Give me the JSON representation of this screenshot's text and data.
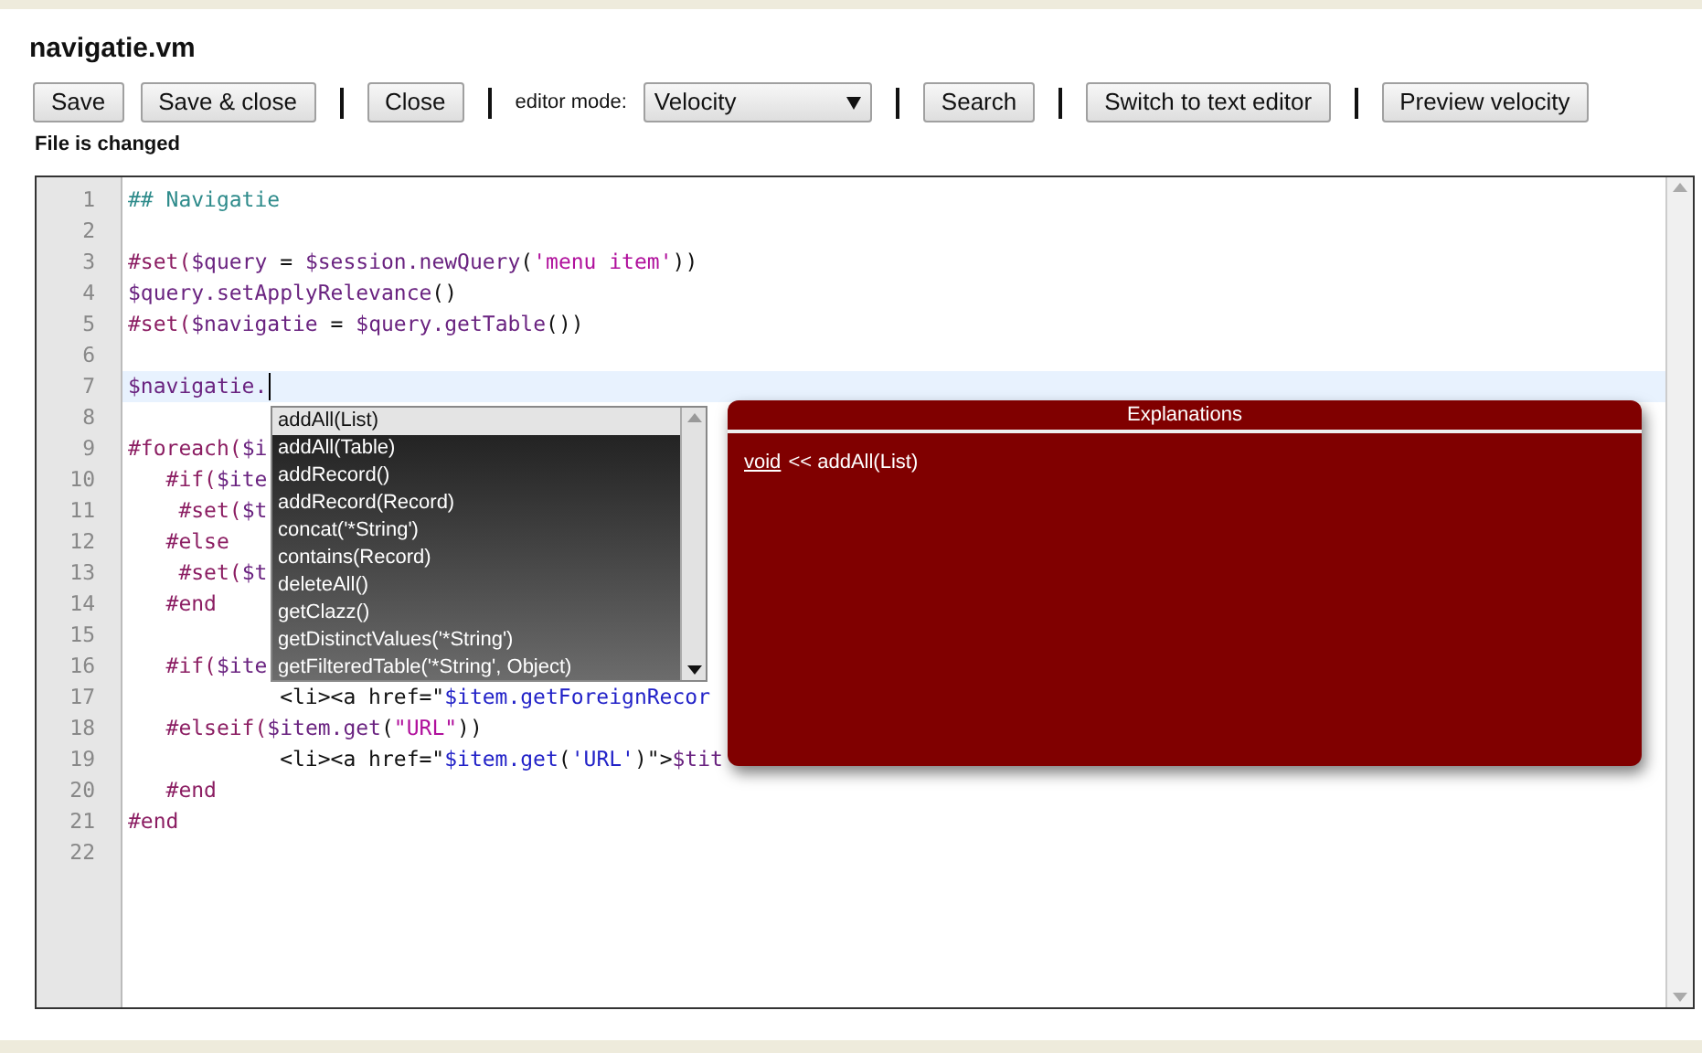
{
  "title": "navigatie.vm",
  "toolbar": [
    {
      "kind": "button",
      "label": "Save"
    },
    {
      "kind": "button",
      "label": "Save & close"
    },
    {
      "kind": "separator"
    },
    {
      "kind": "button",
      "label": "Close"
    },
    {
      "kind": "separator"
    },
    {
      "kind": "label",
      "label": "editor mode:"
    },
    {
      "kind": "select",
      "value": "Velocity"
    },
    {
      "kind": "separator"
    },
    {
      "kind": "button",
      "label": "Search"
    },
    {
      "kind": "separator"
    },
    {
      "kind": "button",
      "label": "Switch to text editor"
    },
    {
      "kind": "separator"
    },
    {
      "kind": "button",
      "label": "Preview velocity"
    }
  ],
  "status": "File is changed",
  "editor": {
    "lines": [
      {
        "number": "1",
        "selected": false,
        "tokens": [
          {
            "kind": "comment",
            "text": "## Navigatie"
          }
        ]
      },
      {
        "number": "2",
        "selected": false
      },
      {
        "number": "3",
        "selected": false,
        "tokens": [
          {
            "kind": "directive",
            "text": "#set("
          },
          {
            "kind": "var",
            "text": "$query"
          },
          {
            "kind": "plain",
            "text": " = "
          },
          {
            "kind": "var",
            "text": "$session.newQuery"
          },
          {
            "kind": "plain",
            "text": "("
          },
          {
            "kind": "string",
            "text": "'menu item'"
          },
          {
            "kind": "plain",
            "text": "))"
          }
        ]
      },
      {
        "number": "4",
        "selected": false,
        "tokens": [
          {
            "kind": "var",
            "text": "$query.setApplyRelevance"
          },
          {
            "kind": "plain",
            "text": "()"
          }
        ]
      },
      {
        "number": "5",
        "selected": false,
        "tokens": [
          {
            "kind": "directive",
            "text": "#set("
          },
          {
            "kind": "var",
            "text": "$navigatie"
          },
          {
            "kind": "plain",
            "text": " = "
          },
          {
            "kind": "var",
            "text": "$query.getTable"
          },
          {
            "kind": "plain",
            "text": "())"
          }
        ]
      },
      {
        "number": "6",
        "selected": false
      },
      {
        "number": "7",
        "selected": true,
        "tokens": [
          {
            "kind": "var",
            "text": "$navigatie."
          }
        ]
      },
      {
        "number": "8",
        "selected": false
      },
      {
        "number": "9",
        "selected": false,
        "tokens": [
          {
            "kind": "directive",
            "text": "#foreach("
          },
          {
            "kind": "var",
            "text": "$i"
          }
        ]
      },
      {
        "number": "10",
        "selected": false,
        "tokens": [
          {
            "kind": "directive",
            "text": "   #if("
          },
          {
            "kind": "var",
            "text": "$ite"
          }
        ]
      },
      {
        "number": "11",
        "selected": false,
        "tokens": [
          {
            "kind": "directive",
            "text": "    #set("
          },
          {
            "kind": "var",
            "text": "$t"
          }
        ]
      },
      {
        "number": "12",
        "selected": false,
        "tokens": [
          {
            "kind": "directive",
            "text": "   #else"
          }
        ]
      },
      {
        "number": "13",
        "selected": false,
        "tokens": [
          {
            "kind": "directive",
            "text": "    #set("
          },
          {
            "kind": "var",
            "text": "$t"
          }
        ]
      },
      {
        "number": "14",
        "selected": false,
        "tokens": [
          {
            "kind": "directive",
            "text": "   #end"
          }
        ]
      },
      {
        "number": "15",
        "selected": false
      },
      {
        "number": "16",
        "selected": false,
        "tokens": [
          {
            "kind": "directive",
            "text": "   #if("
          },
          {
            "kind": "var",
            "text": "$ite"
          }
        ]
      },
      {
        "number": "17",
        "selected": false,
        "tokens": [
          {
            "kind": "plain",
            "text": "            <li><a href=\""
          },
          {
            "kind": "link",
            "text": "$item.getForeignRecor"
          }
        ]
      },
      {
        "number": "18",
        "selected": false,
        "tokens": [
          {
            "kind": "directive",
            "text": "   #elseif("
          },
          {
            "kind": "var",
            "text": "$item.get"
          },
          {
            "kind": "plain",
            "text": "("
          },
          {
            "kind": "string",
            "text": "\"URL\""
          },
          {
            "kind": "plain",
            "text": "))"
          }
        ]
      },
      {
        "number": "19",
        "selected": false,
        "tokens": [
          {
            "kind": "plain",
            "text": "            <li><a href=\""
          },
          {
            "kind": "link",
            "text": "$item.get"
          },
          {
            "kind": "plain",
            "text": "("
          },
          {
            "kind": "link",
            "text": "'URL'"
          },
          {
            "kind": "plain",
            "text": ")\">"
          },
          {
            "kind": "var",
            "text": "$tit"
          }
        ]
      },
      {
        "number": "20",
        "selected": false,
        "tokens": [
          {
            "kind": "directive",
            "text": "   #end"
          }
        ]
      },
      {
        "number": "21",
        "selected": false,
        "tokens": [
          {
            "kind": "directive",
            "text": "#end"
          }
        ]
      },
      {
        "number": "22",
        "selected": false
      }
    ]
  },
  "autocomplete": [
    {
      "label": "addAll(List)",
      "selected": true
    },
    {
      "label": "addAll(Table)",
      "selected": false
    },
    {
      "label": "addRecord()",
      "selected": false
    },
    {
      "label": "addRecord(Record)",
      "selected": false
    },
    {
      "label": "concat('*String')",
      "selected": false
    },
    {
      "label": "contains(Record)",
      "selected": false
    },
    {
      "label": "deleteAll()",
      "selected": false
    },
    {
      "label": "getClazz()",
      "selected": false
    },
    {
      "label": "getDistinctValues('*String')",
      "selected": false
    },
    {
      "label": "getFilteredTable('*String', Object)",
      "selected": false
    }
  ],
  "explanations": {
    "title": "Explanations",
    "return_type": "void",
    "signature": "<< addAll(List)"
  }
}
